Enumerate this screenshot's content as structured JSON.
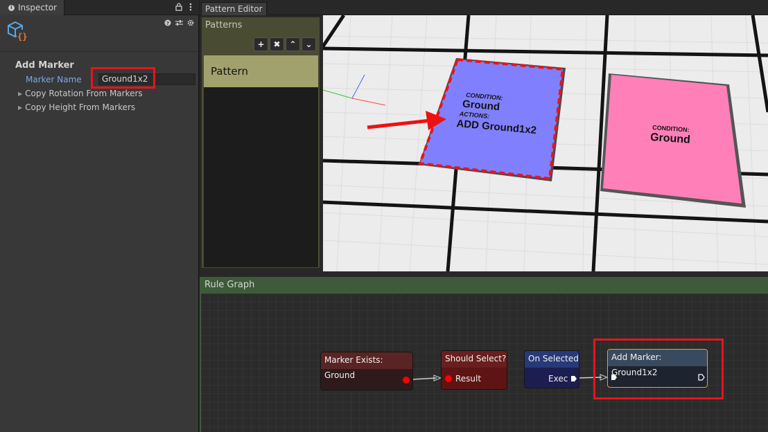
{
  "inspector": {
    "tab_label": "Inspector",
    "lock_icon": "lock-icon",
    "menu_icon": "kebab-menu-icon",
    "component_icon": "cube-script-icon",
    "help_icon": "help-icon",
    "presets_icon": "sliders-icon",
    "settings_icon": "gear-icon",
    "section_title": "Add Marker",
    "marker_name_label": "Marker Name",
    "marker_name_value": "Ground1x2",
    "foldouts": [
      "Copy Rotation From Markers",
      "Copy Height From Markers"
    ]
  },
  "editor": {
    "tab_label": "Pattern Editor",
    "patterns": {
      "title": "Patterns",
      "tools": [
        "+",
        "✖",
        "⌃",
        "⌄"
      ],
      "items": [
        "Pattern"
      ]
    },
    "viewport": {
      "left_tile": {
        "condition_label": "CONDITION:",
        "condition_value": "Ground",
        "actions_label": "ACTIONS:",
        "actions_value": "ADD Ground1x2"
      },
      "right_tile": {
        "condition_label": "CONDITION:",
        "condition_value": "Ground"
      }
    },
    "rule_graph": {
      "title": "Rule Graph",
      "nodes": {
        "marker_exists": {
          "title": "Marker Exists: Ground"
        },
        "should_select": {
          "title": "Should Select?",
          "port": "Result"
        },
        "on_selected": {
          "title": "On Selected",
          "port": "Exec"
        },
        "add_marker": {
          "title": "Add Marker: Ground1x2"
        }
      }
    }
  },
  "colors": {
    "highlight": "#e8141c",
    "left_tile": "#8080ff",
    "right_tile": "#ff80b8",
    "patterns_selected": "#a1a16d"
  }
}
